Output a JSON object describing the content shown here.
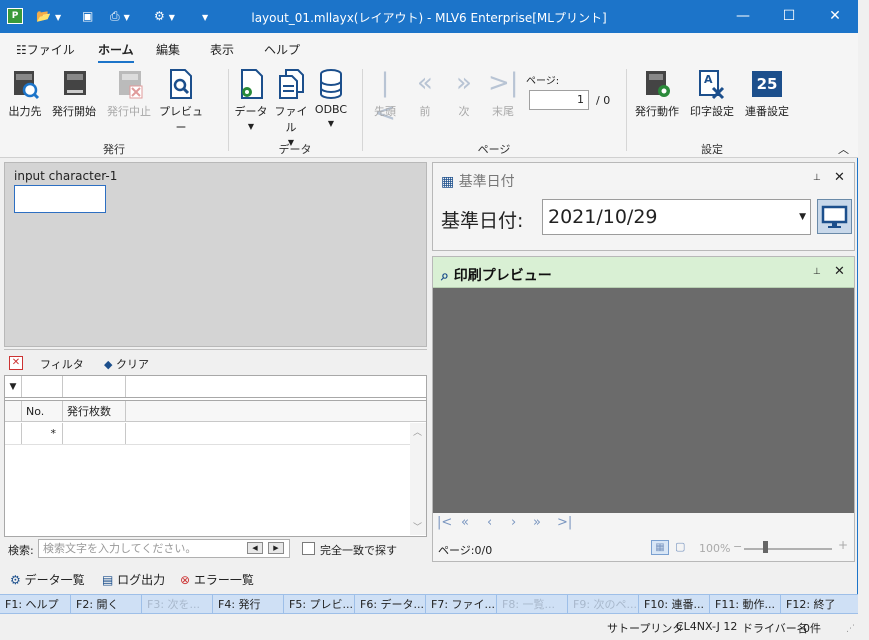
{
  "window": {
    "title": "layout_01.mllayx(レイアウト) - MLV6 Enterprise[MLプリント]",
    "app_icon_text": "P",
    "minimize": "—",
    "maximize": "☐",
    "close": "✕"
  },
  "menu": {
    "tabs": [
      {
        "label": "ファイル"
      },
      {
        "label": "ホーム"
      },
      {
        "label": "編集"
      },
      {
        "label": "表示"
      },
      {
        "label": "ヘルプ"
      }
    ],
    "active_tab": "ホーム"
  },
  "ribbon": {
    "groups": {
      "issue": "発行",
      "data": "データ",
      "page": "ページ",
      "settings": "設定"
    },
    "buttons": {
      "output_dest": "出力先",
      "start_issue": "発行開始",
      "stop_issue": "発行中止",
      "preview": "プレビュー",
      "data": "データ",
      "file": "ファイル",
      "odbc": "ODBC",
      "first": "先頭",
      "prev": "前",
      "next": "次",
      "last": "末尾",
      "issue_action": "発行動作",
      "print_settings": "印字設定",
      "serial_settings": "連番設定"
    },
    "page_label": "ページ:",
    "page_value": "1",
    "page_total": "/ 0",
    "serial_icon_text": "25"
  },
  "design": {
    "field_label": "input character-1"
  },
  "filter": {
    "filter_label": "フィルタ",
    "clear_label": "クリア"
  },
  "grid": {
    "columns": [
      "No.",
      "発行枚数"
    ],
    "new_row_marker": "*"
  },
  "search": {
    "label": "検索:",
    "placeholder": "検索文字を入力してください。",
    "exact_match": "完全一致で探す"
  },
  "date_pane": {
    "header": "基準日付",
    "label": "基準日付:",
    "value": "2021/10/29"
  },
  "preview_pane": {
    "header": "印刷プレビュー",
    "page_status": "ページ:0/0",
    "zoom": "100%"
  },
  "links": {
    "data_list": "データ一覧",
    "log_output": "ログ出力",
    "error_list": "エラー一覧"
  },
  "fkeys": [
    {
      "label": "F1: ヘルプ",
      "enabled": true
    },
    {
      "label": "F2: 開く",
      "enabled": true
    },
    {
      "label": "F3: 次を...",
      "enabled": false
    },
    {
      "label": "F4: 発行",
      "enabled": true
    },
    {
      "label": "F5: プレビ...",
      "enabled": true
    },
    {
      "label": "F6: データ...",
      "enabled": true
    },
    {
      "label": "F7: ファイ...",
      "enabled": true
    },
    {
      "label": "F8: 一覧...",
      "enabled": false
    },
    {
      "label": "F9: 次のペ...",
      "enabled": false
    },
    {
      "label": "F10: 連番...",
      "enabled": true
    },
    {
      "label": "F11: 動作...",
      "enabled": true
    },
    {
      "label": "F12: 終了",
      "enabled": true
    }
  ],
  "status": {
    "printer_label": "サトープリンタ",
    "printer_model": "CL4NX-J 12",
    "driver_label": "ドライバー名",
    "count": "0件"
  },
  "colors": {
    "titlebar": "#1c74c9",
    "fkey_bar": "#cfe0f5",
    "preview_header": "#d9f0d4",
    "preview_canvas": "#6b6b6b"
  }
}
